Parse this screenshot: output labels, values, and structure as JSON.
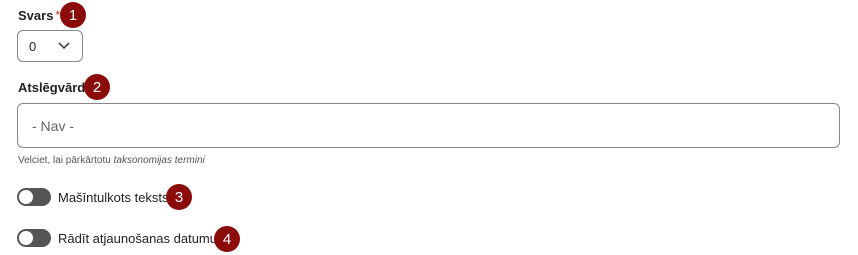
{
  "weight": {
    "label": "Svars",
    "required_mark": "*",
    "badge": "1",
    "selected_value": "0"
  },
  "keywords": {
    "label": "Atslēgvārdi",
    "badge": "2",
    "placeholder": "- Nav -",
    "help_prefix": "Velciet, lai pārkārtotu",
    "help_emphasis": "taksonomijas termini"
  },
  "toggles": [
    {
      "label": "Mašīntulkots teksts",
      "badge": "3",
      "on": false
    },
    {
      "label": "Rādīt atjaunošanas datumu",
      "badge": "4",
      "on": false
    }
  ],
  "colors": {
    "badge": "#8b0a0a",
    "required": "#c0392b",
    "toggle_off": "#555555"
  }
}
